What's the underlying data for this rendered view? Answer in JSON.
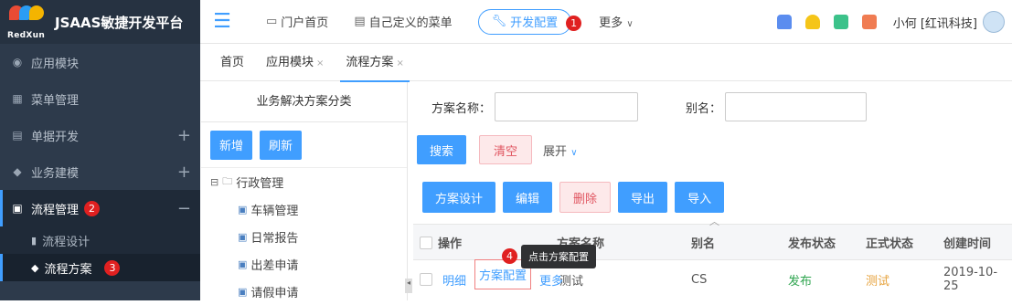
{
  "app": {
    "title": "JSAAS敏捷开发平台",
    "logo_text": "RedXun"
  },
  "sidebar": {
    "items": [
      {
        "label": "应用模块",
        "icon": "app-module-icon",
        "plus": ""
      },
      {
        "label": "菜单管理",
        "icon": "grid-icon",
        "plus": ""
      },
      {
        "label": "单据开发",
        "icon": "form-icon",
        "plus": "+"
      },
      {
        "label": "业务建模",
        "icon": "cube-icon",
        "plus": "+"
      },
      {
        "label": "流程管理",
        "icon": "process-icon",
        "plus": "−",
        "badge": "2"
      }
    ],
    "sub_items": [
      {
        "label": "流程设计",
        "icon": "document-icon"
      },
      {
        "label": "流程方案",
        "icon": "cube-icon",
        "badge": "3"
      }
    ]
  },
  "topbar": {
    "nav": [
      {
        "label": "门户首页",
        "icon": "monitor-icon"
      },
      {
        "label": "自己定义的菜单",
        "icon": "list-icon"
      }
    ],
    "dev_config": {
      "label": "开发配置",
      "badge": "1"
    },
    "more": "更多",
    "user": "小何 [红讯科技]"
  },
  "tabs": [
    {
      "label": "首页"
    },
    {
      "label": "应用模块",
      "close": "×"
    },
    {
      "label": "流程方案",
      "close": "×"
    }
  ],
  "tree": {
    "header": "业务解决方案分类",
    "buttons": {
      "add": "新增",
      "refresh": "刷新"
    },
    "root": "行政管理",
    "children": [
      "车辆管理",
      "日常报告",
      "出差申请",
      "请假申请"
    ]
  },
  "search": {
    "name_label": "方案名称：",
    "alias_label": "别名：",
    "search": "搜索",
    "clear": "清空",
    "expand": "展开"
  },
  "actions": {
    "design": "方案设计",
    "edit": "编辑",
    "delete": "删除",
    "export": "导出",
    "import": "导入"
  },
  "table": {
    "headers": {
      "op": "操作",
      "name": "方案名称",
      "alias": "别名",
      "publish": "发布状态",
      "formal": "正式状态",
      "created": "创建时间"
    },
    "row": {
      "detail": "明细",
      "config": "方案配置",
      "more": "更多",
      "name": "测试",
      "alias": "CS",
      "publish": "发布",
      "formal": "测试",
      "created": "2019-10-25"
    }
  },
  "tooltip": {
    "text": "点击方案配置",
    "badge": "4"
  },
  "colors": {
    "accent": "#409eff",
    "sidebar_bg": "#2d3a4b",
    "badge": "#e02020"
  }
}
